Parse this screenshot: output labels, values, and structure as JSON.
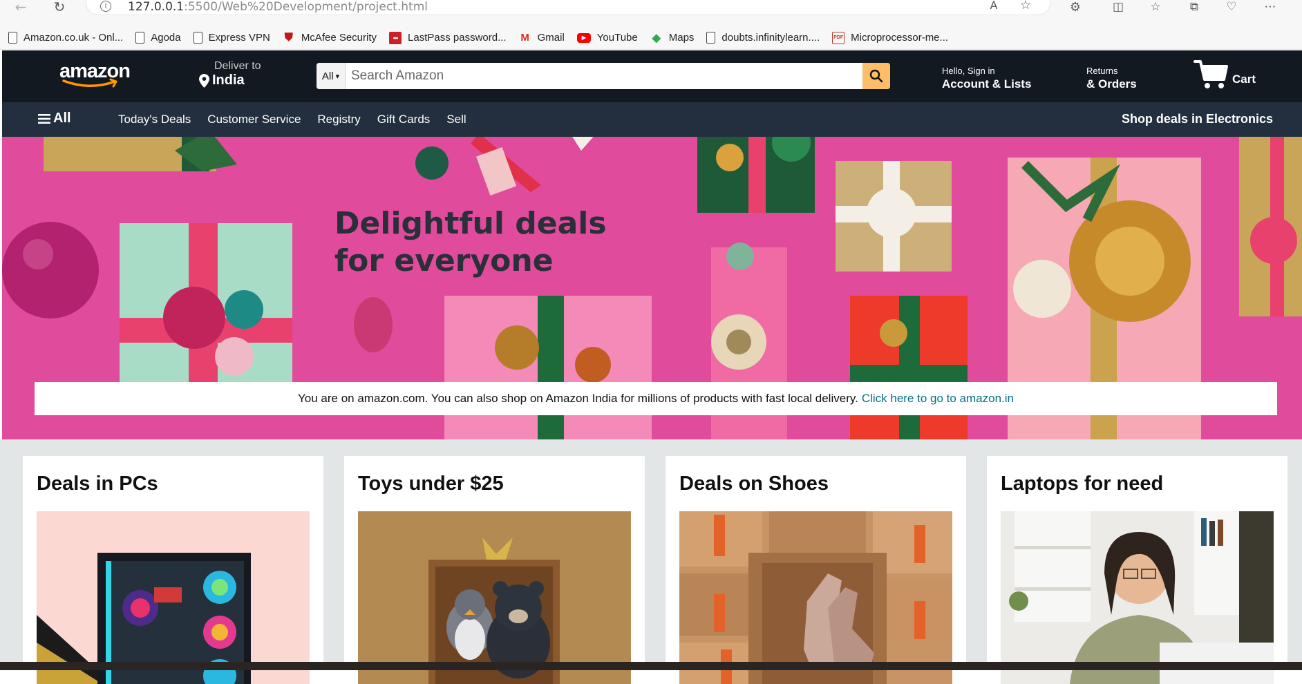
{
  "browser": {
    "url_host": "127.0.0.1",
    "url_rest": ":5500/Web%20Development/project.html",
    "bookmarks": [
      {
        "label": "Amazon.co.uk - Onl...",
        "icon": "page-icon"
      },
      {
        "label": "Agoda",
        "icon": "page-icon"
      },
      {
        "label": "Express VPN",
        "icon": "page-icon"
      },
      {
        "label": "McAfee Security",
        "icon": "mcafee-icon"
      },
      {
        "label": "LastPass password...",
        "icon": "lastpass-icon"
      },
      {
        "label": "Gmail",
        "icon": "gmail-icon"
      },
      {
        "label": "YouTube",
        "icon": "youtube-icon"
      },
      {
        "label": "Maps",
        "icon": "maps-icon"
      },
      {
        "label": "doubts.infinitylearn....",
        "icon": "page-icon"
      },
      {
        "label": "Microprocessor-me...",
        "icon": "pdf-icon"
      }
    ]
  },
  "nav": {
    "logo": "amazon",
    "deliver_to": "Deliver to",
    "location": "India",
    "search_category": "All",
    "search_placeholder": "Search Amazon",
    "account_greeting": "Hello, Sign in",
    "account_label": "Account & Lists",
    "returns_label": "Returns",
    "orders_label": "& Orders",
    "cart_label": "Cart"
  },
  "subnav": {
    "all_label": "All",
    "links": [
      "Today's Deals",
      "Customer Service",
      "Registry",
      "Gift Cards",
      "Sell"
    ],
    "promo": "Shop deals in Electronics"
  },
  "hero": {
    "heading_line1": "Delightful deals",
    "heading_line2": "for everyone",
    "notice_text": "You are on amazon.com. You can also shop on Amazon India for millions of products with fast local delivery.",
    "notice_link": "Click here to go to amazon.in"
  },
  "cards": [
    {
      "title": "Deals in PCs"
    },
    {
      "title": "Toys under $25"
    },
    {
      "title": "Deals on Shoes"
    },
    {
      "title": "Laptops for need"
    }
  ],
  "colors": {
    "nav_bg": "#131921",
    "subnav_bg": "#232f3e",
    "search_button": "#febd69",
    "hero_pink": "#e04b9b",
    "link": "#007185",
    "cards_bg": "#e3e6e6"
  }
}
